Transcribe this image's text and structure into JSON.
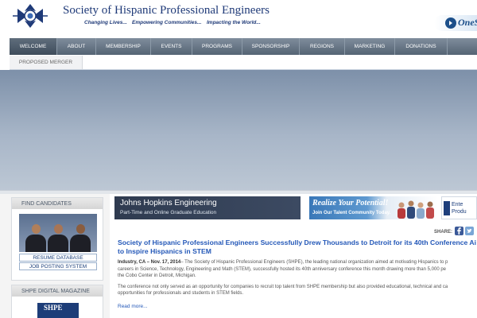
{
  "header": {
    "title": "Society of Hispanic Professional Engineers",
    "taglines": [
      "Changing Lives...",
      "Empowering Communities...",
      "Impacting the World..."
    ],
    "badge_text": "OneS"
  },
  "nav": {
    "items": [
      {
        "label": "Welcome",
        "active": true
      },
      {
        "label": "About"
      },
      {
        "label": "Membership"
      },
      {
        "label": "Events"
      },
      {
        "label": "Programs"
      },
      {
        "label": "Sponsorship"
      },
      {
        "label": "Regions"
      },
      {
        "label": "Marketing"
      },
      {
        "label": "Donations"
      }
    ],
    "sub_item": "Proposed Merger"
  },
  "sidebar": {
    "find_candidates": {
      "title": "Find Candidates",
      "links": [
        "Resume Database",
        "Job Posting System"
      ]
    },
    "magazine": {
      "title": "SHPE Digital Magazine",
      "cover_title": "SHPE"
    }
  },
  "banners": {
    "jhu": {
      "title": "Johns Hopkins Engineering",
      "subtitle": "Part-Time and Online Graduate Education"
    },
    "realize": {
      "title": "Realize Your Potential!",
      "subtitle": "Join Our Talent Community Today."
    },
    "enterprise": {
      "line1": "Ente",
      "line2": "Produ"
    }
  },
  "share": {
    "label": "Share:"
  },
  "article": {
    "headline_1": "Society of Hispanic Professional Engineers Successfully Drew Thousands to Detroit for its 40th Conference Ai",
    "headline_2": "to Inspire Hispanics in STEM",
    "dateline": "Industry, CA – Nov. 17, 2014",
    "p1_line1": "– The Society of Hispanic Professional Engineers (SHPE), the leading national organization aimed at motivating Hispanics to p",
    "p1_line2": "careers in Science, Technology, Engineering and Math (STEM), successfully hosted its 40th anniversary conference this month drawing more than 5,000 pe",
    "p1_line3": "the Cobo Center in Detroit, Michigan.",
    "p2_line1": "The conference not only served as an opportunity for companies to recruit top talent from SHPE membership but also provided educational, technical and ca",
    "p2_line2": "opportunities for professionals and students in STEM fields.",
    "read_more": "Read more..."
  }
}
